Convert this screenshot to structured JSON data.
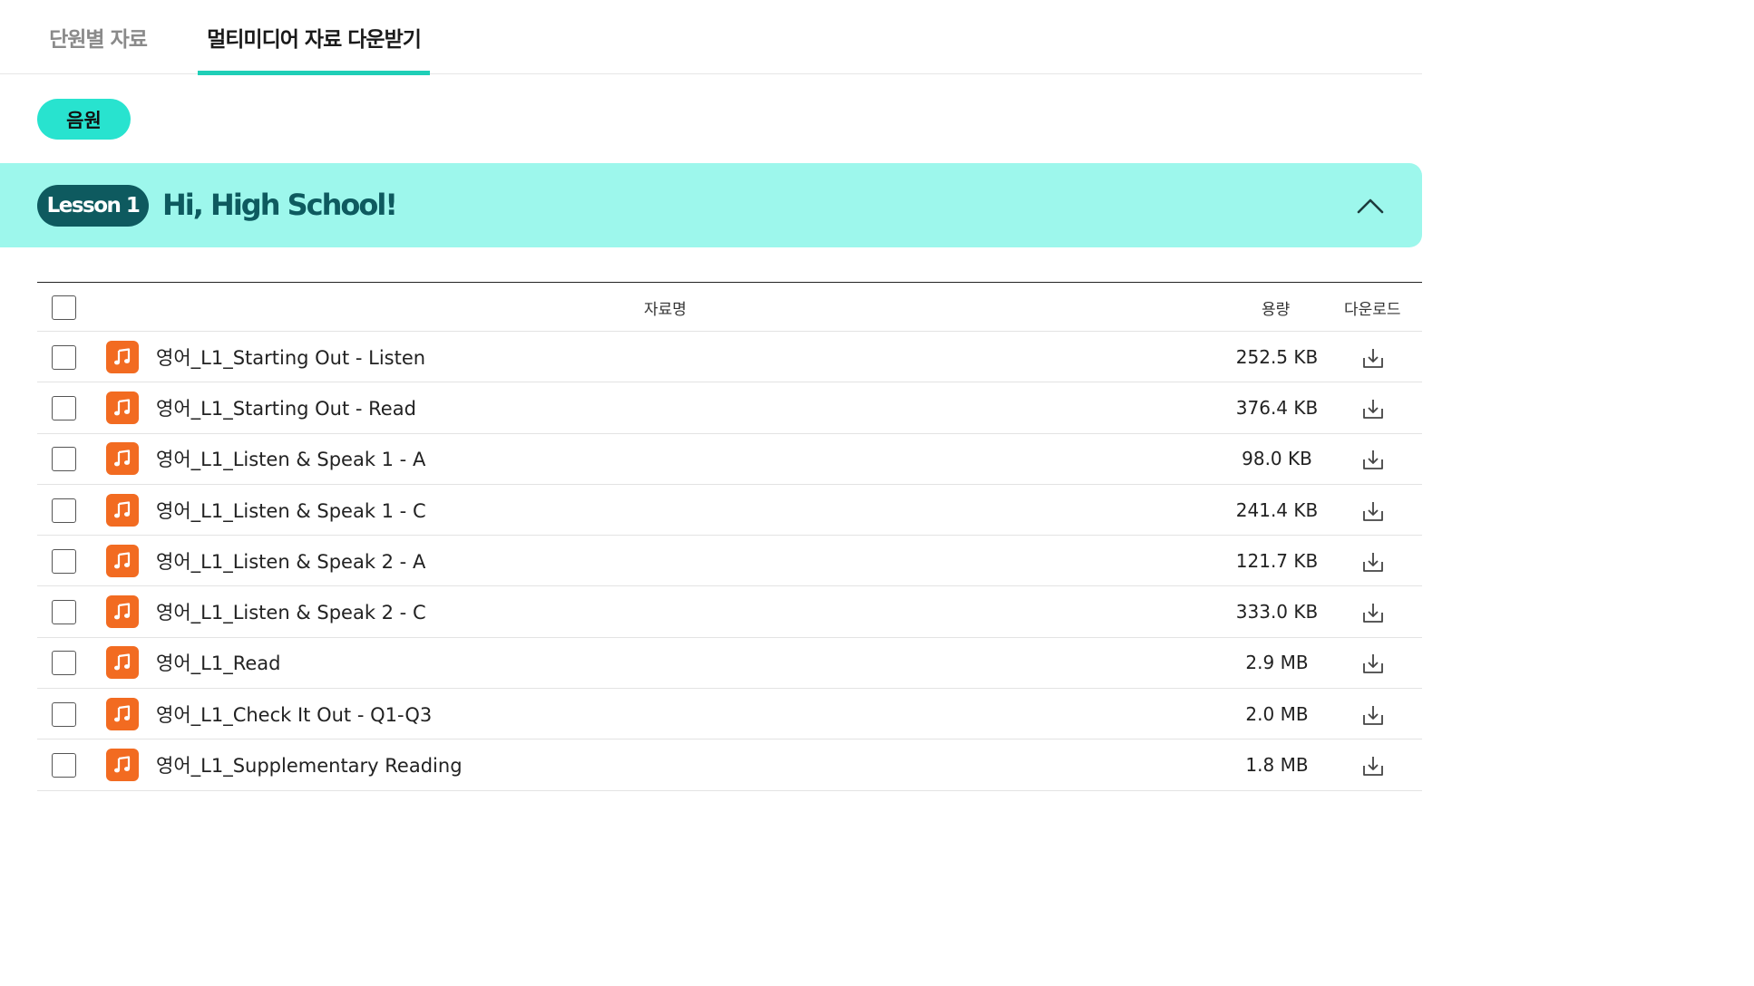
{
  "tabs": [
    {
      "label": "단원별 자료"
    },
    {
      "label": "멀티미디어 자료 다운받기"
    }
  ],
  "filter": {
    "label": "음원"
  },
  "lesson": {
    "badge": "Lesson 1",
    "title": "Hi, High School!",
    "toggle_icon": "chevron-up-icon"
  },
  "table": {
    "headers": {
      "name": "자료명",
      "size": "용량",
      "download": "다운로드"
    },
    "rows": [
      {
        "name": "영어_L1_Starting Out - Listen",
        "size": "252.5 KB"
      },
      {
        "name": "영어_L1_Starting Out - Read",
        "size": "376.4 KB"
      },
      {
        "name": "영어_L1_Listen & Speak 1 - A",
        "size": "98.0 KB"
      },
      {
        "name": "영어_L1_Listen & Speak 1 - C",
        "size": "241.4 KB"
      },
      {
        "name": "영어_L1_Listen & Speak 2 - A",
        "size": "121.7 KB"
      },
      {
        "name": "영어_L1_Listen & Speak 2 - C",
        "size": "333.0 KB"
      },
      {
        "name": "영어_L1_Read",
        "size": "2.9 MB"
      },
      {
        "name": "영어_L1_Check It Out - Q1-Q3",
        "size": "2.0 MB"
      },
      {
        "name": "영어_L1_Supplementary Reading",
        "size": "1.8 MB"
      }
    ]
  },
  "icons": {
    "file": "music-note-icon",
    "download": "download-icon"
  },
  "colors": {
    "accent": "#1fcfb7",
    "pill": "#28e3cf",
    "banner": "#9df7ec",
    "badge": "#0e5a5f",
    "file_icon": "#f26b21"
  }
}
